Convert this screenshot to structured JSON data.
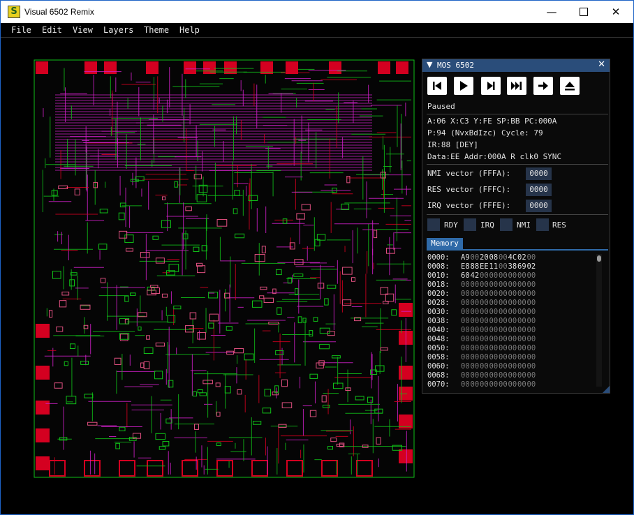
{
  "window": {
    "title": "Visual 6502 Remix",
    "icon": "app-icon"
  },
  "menu": [
    "File",
    "Edit",
    "View",
    "Layers",
    "Theme",
    "Help"
  ],
  "panel": {
    "title": "MOS 6502",
    "toolbar": [
      "reset-to-start-icon",
      "play-icon",
      "step-icon",
      "fast-forward-icon",
      "step-over-icon",
      "eject-icon"
    ],
    "status": "Paused",
    "regs_line1": "A:06 X:C3 Y:FE SP:BB PC:000A",
    "regs_line2": "P:94 (NvxBdIzc) Cycle: 79",
    "regs_line3": "IR:88 [DEY]",
    "regs_line4": "Data:EE Addr:000A R clk0 SYNC",
    "vectors": [
      {
        "label": "NMI vector (FFFA):",
        "value": "0000"
      },
      {
        "label": "RES vector (FFFC):",
        "value": "0000"
      },
      {
        "label": "IRQ vector (FFFE):",
        "value": "0000"
      }
    ],
    "pins": [
      "RDY",
      "IRQ",
      "NMI",
      "RES"
    ],
    "memory_tab": "Memory",
    "memory": [
      {
        "addr": "0000:",
        "bytes": [
          "A9",
          "00",
          "20",
          "08",
          "00",
          "4C",
          "02",
          "00"
        ]
      },
      {
        "addr": "0008:",
        "bytes": [
          "E8",
          "88",
          "EE",
          "11",
          "00",
          "38",
          "69",
          "02"
        ]
      },
      {
        "addr": "0010:",
        "bytes": [
          "60",
          "42",
          "00",
          "00",
          "00",
          "00",
          "00",
          "00"
        ]
      },
      {
        "addr": "0018:",
        "bytes": [
          "00",
          "00",
          "00",
          "00",
          "00",
          "00",
          "00",
          "00"
        ]
      },
      {
        "addr": "0020:",
        "bytes": [
          "00",
          "00",
          "00",
          "00",
          "00",
          "00",
          "00",
          "00"
        ]
      },
      {
        "addr": "0028:",
        "bytes": [
          "00",
          "00",
          "00",
          "00",
          "00",
          "00",
          "00",
          "00"
        ]
      },
      {
        "addr": "0030:",
        "bytes": [
          "00",
          "00",
          "00",
          "00",
          "00",
          "00",
          "00",
          "00"
        ]
      },
      {
        "addr": "0038:",
        "bytes": [
          "00",
          "00",
          "00",
          "00",
          "00",
          "00",
          "00",
          "00"
        ]
      },
      {
        "addr": "0040:",
        "bytes": [
          "00",
          "00",
          "00",
          "00",
          "00",
          "00",
          "00",
          "00"
        ]
      },
      {
        "addr": "0048:",
        "bytes": [
          "00",
          "00",
          "00",
          "00",
          "00",
          "00",
          "00",
          "00"
        ]
      },
      {
        "addr": "0050:",
        "bytes": [
          "00",
          "00",
          "00",
          "00",
          "00",
          "00",
          "00",
          "00"
        ]
      },
      {
        "addr": "0058:",
        "bytes": [
          "00",
          "00",
          "00",
          "00",
          "00",
          "00",
          "00",
          "00"
        ]
      },
      {
        "addr": "0060:",
        "bytes": [
          "00",
          "00",
          "00",
          "00",
          "00",
          "00",
          "00",
          "00"
        ]
      },
      {
        "addr": "0068:",
        "bytes": [
          "00",
          "00",
          "00",
          "00",
          "00",
          "00",
          "00",
          "00"
        ]
      },
      {
        "addr": "0070:",
        "bytes": [
          "00",
          "00",
          "00",
          "00",
          "00",
          "00",
          "00",
          "00"
        ]
      }
    ]
  },
  "colors": {
    "accent": "#2f6aa8",
    "panel_title": "#2a4d7a",
    "chip_red": "#d40020",
    "chip_green": "#10c018",
    "chip_magenta": "#d020c8",
    "chip_pink": "#e05080"
  }
}
